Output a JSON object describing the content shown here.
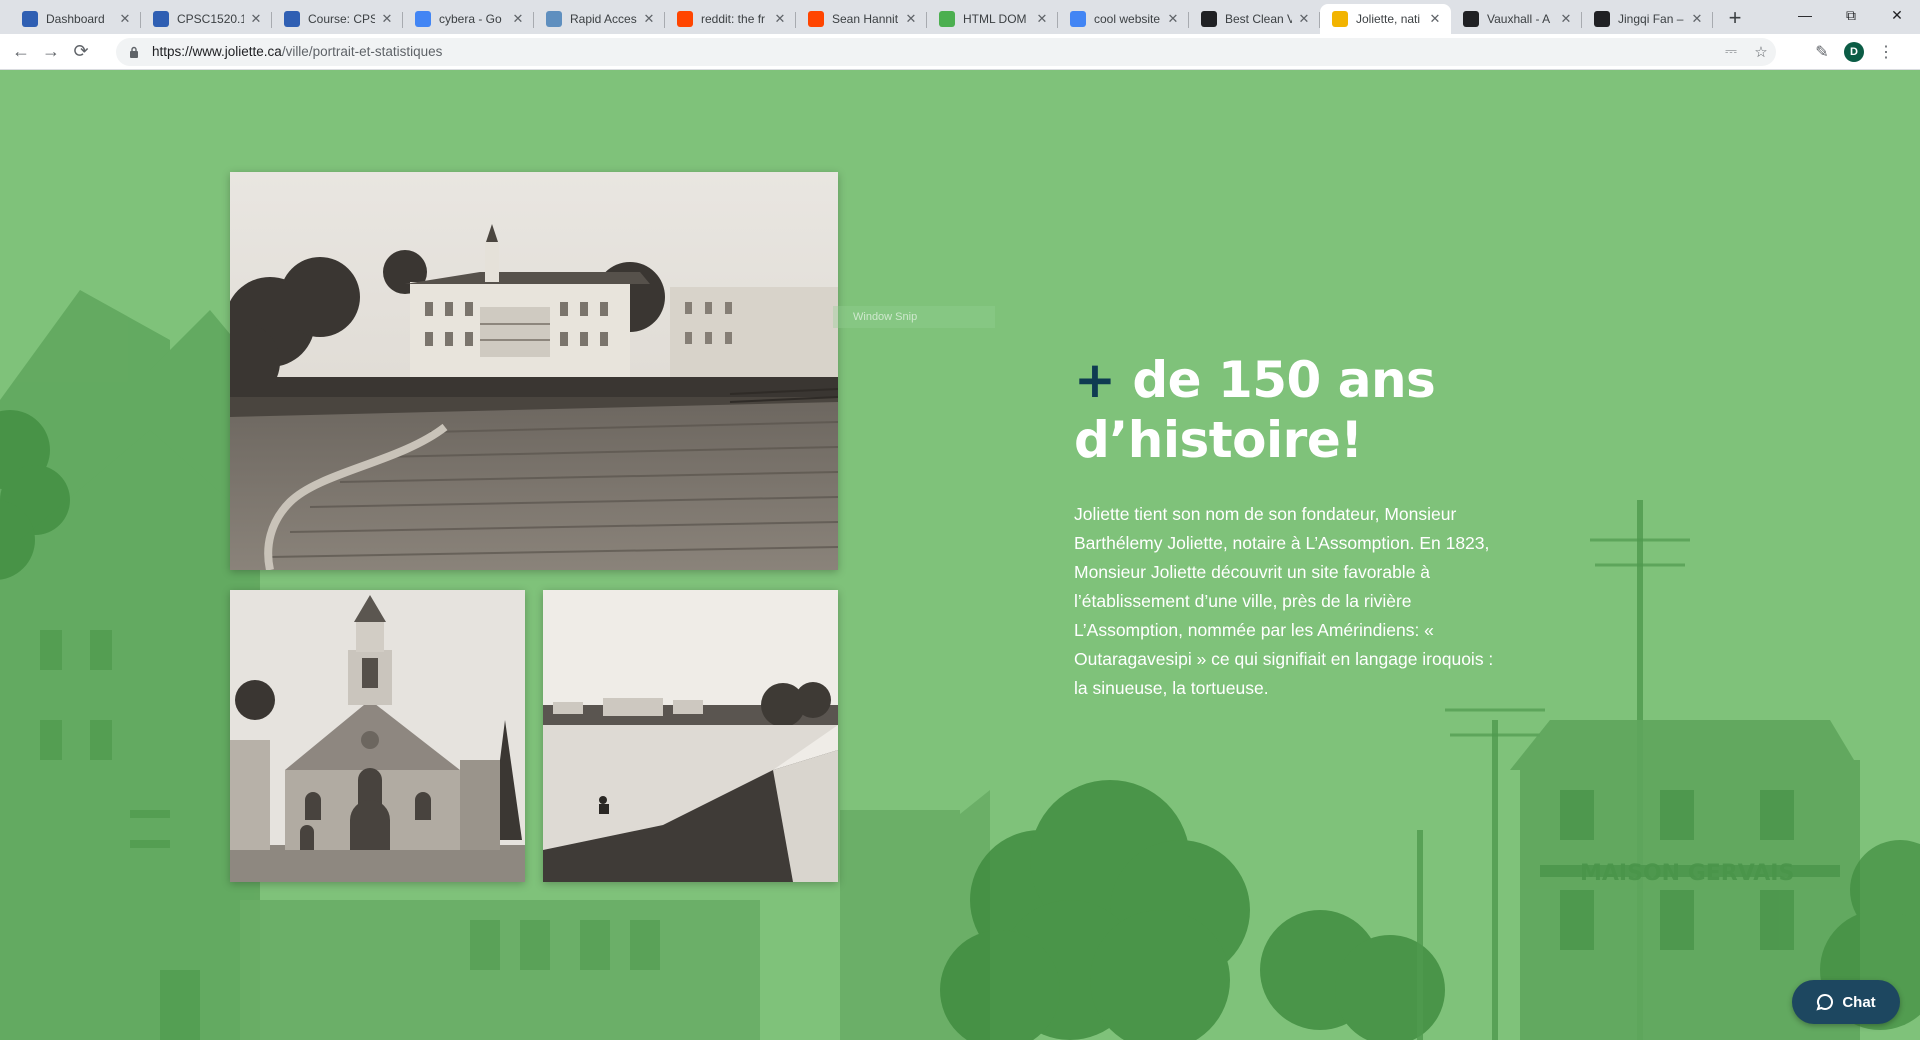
{
  "browser": {
    "tabs": [
      {
        "title": "Dashboard",
        "favicon": "shield-favicon",
        "color": "#2f5fb3"
      },
      {
        "title": "CPSC1520.1",
        "favicon": "shield-favicon",
        "color": "#2f5fb3"
      },
      {
        "title": "Course: CPS",
        "favicon": "shield-favicon",
        "color": "#2f5fb3"
      },
      {
        "title": "cybera - Go",
        "favicon": "google-favicon",
        "color": "#4285f4"
      },
      {
        "title": "Rapid Acces",
        "favicon": "cloud-favicon",
        "color": "#5f8fbf"
      },
      {
        "title": "reddit: the fr",
        "favicon": "reddit-favicon",
        "color": "#ff4500"
      },
      {
        "title": "Sean Hannit",
        "favicon": "reddit-favicon",
        "color": "#ff4500"
      },
      {
        "title": "HTML DOM",
        "favicon": "w3-favicon",
        "color": "#4caf50"
      },
      {
        "title": "cool website",
        "favicon": "google-favicon",
        "color": "#4285f4"
      },
      {
        "title": "Best Clean V",
        "favicon": "wikipedia-favicon",
        "color": "#202124"
      },
      {
        "title": "Joliette, nati",
        "favicon": "sun-favicon",
        "color": "#f2b400"
      },
      {
        "title": "Vauxhall - A",
        "favicon": "wikipedia-favicon",
        "color": "#202124"
      },
      {
        "title": "Jingqi Fan –",
        "favicon": "wikipedia-favicon",
        "color": "#202124"
      }
    ],
    "active_tab_index": 10,
    "address": {
      "scheme_host": "https://www.joliette.ca",
      "path": "/ville/portrait-et-statistiques"
    },
    "profile_initial": "D"
  },
  "page": {
    "heading_plus": "+",
    "heading_line1": "de 150 ans",
    "heading_line2": "d’histoire!",
    "intro": "Joliette tient son nom de son fondateur, Monsieur Barthélemy Joliette, notaire à L’Assomption. En 1823, Monsieur Joliette découvrit un site favorable à l’établissement d’une ville, près de la rivière L’Assomption, nommée par les Amérindiens: « Outaragavesipi » ce qui signifiait en langage iroquois : la sinueuse, la tortueuse.",
    "snip_overlay_text": "Window Snip",
    "bg_sign_text": "MAISON GERVAIS",
    "chat_label": "Chat"
  },
  "colors": {
    "page_green": "#7fc27a",
    "heading_plus": "#0f3b52",
    "chat_button": "#1d4760"
  }
}
